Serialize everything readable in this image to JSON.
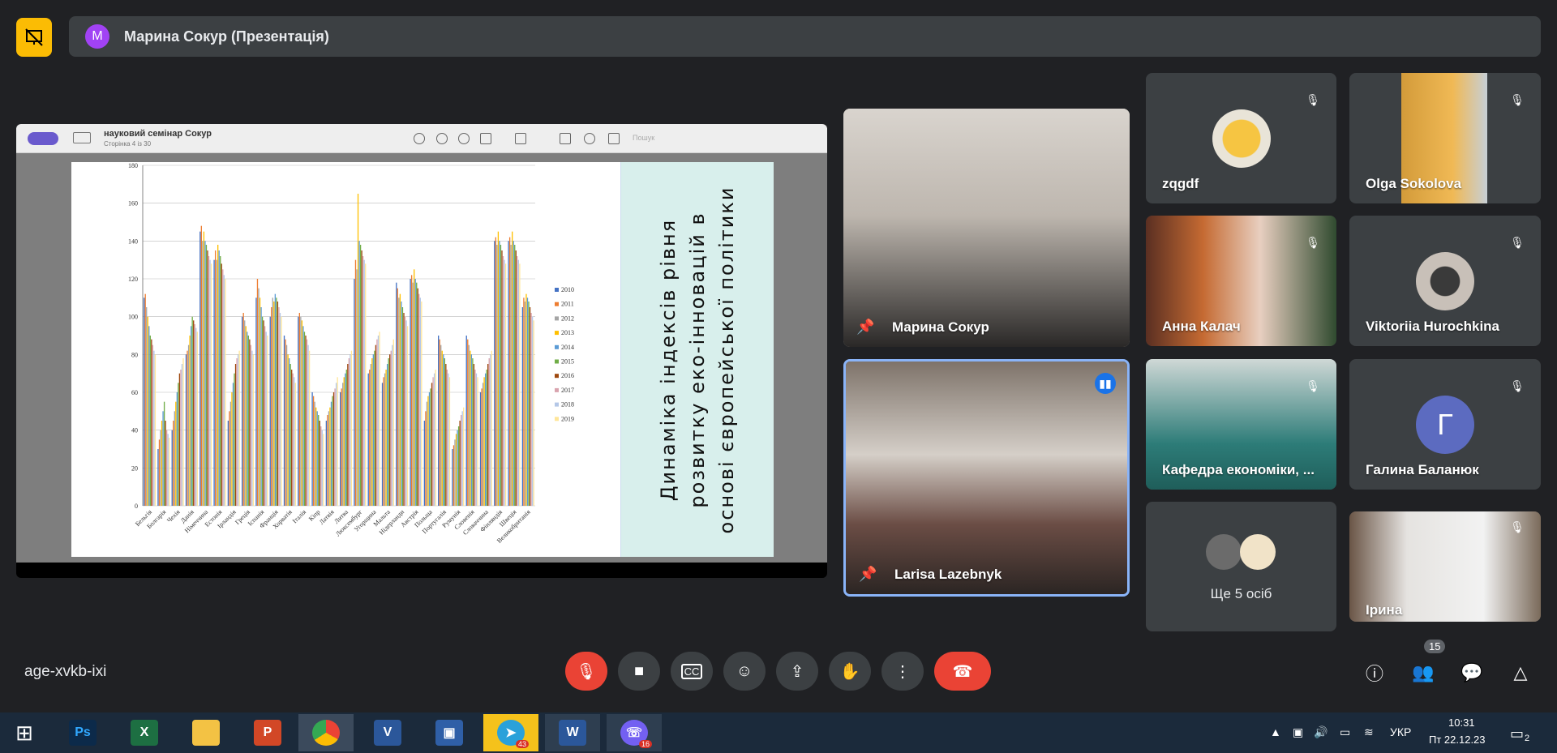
{
  "meeting": {
    "presenter_label": "Марина Сокур (Презентація)",
    "presenter_initial": "M",
    "code": "age-xvkb-ixi",
    "people_count": "15"
  },
  "viewer": {
    "doc_title": "науковий семінар Сокур",
    "doc_page": "Сторінка 4 із 30",
    "search_placeholder": "Пошук"
  },
  "slide": {
    "title": "Динаміка індексів рівня розвитку еко-інновацій в основі європейської політики"
  },
  "chart_data": {
    "type": "bar",
    "categories": [
      "Бельгія",
      "Болгарія",
      "Чехія",
      "Данія",
      "Німеччина",
      "Естонія",
      "Ірландія",
      "Греція",
      "Іспанія",
      "Франція",
      "Хорватія",
      "Італія",
      "Кіпр",
      "Латвія",
      "Литва",
      "Люксембург",
      "Угорщина",
      "Мальта",
      "Нідерланди",
      "Австрія",
      "Польща",
      "Португалія",
      "Румунія",
      "Словенія",
      "Словаччина",
      "Фінляндія",
      "Швеція",
      "Великобританія"
    ],
    "series": [
      {
        "name": "2010",
        "values": [
          110,
          30,
          40,
          80,
          145,
          130,
          45,
          100,
          110,
          100,
          90,
          100,
          60,
          45,
          60,
          120,
          70,
          65,
          118,
          120,
          45,
          90,
          30,
          90,
          60,
          140,
          140,
          105
        ]
      },
      {
        "name": "2011",
        "values": [
          112,
          35,
          45,
          82,
          148,
          135,
          50,
          102,
          120,
          105,
          88,
          102,
          58,
          48,
          62,
          130,
          72,
          68,
          115,
          122,
          50,
          88,
          32,
          88,
          62,
          142,
          142,
          110
        ]
      },
      {
        "name": "2012",
        "values": [
          105,
          40,
          50,
          85,
          140,
          130,
          55,
          98,
          115,
          110,
          85,
          100,
          55,
          50,
          65,
          125,
          75,
          70,
          110,
          118,
          55,
          85,
          35,
          85,
          65,
          138,
          138,
          108
        ]
      },
      {
        "name": "2013",
        "values": [
          100,
          45,
          55,
          90,
          145,
          138,
          60,
          95,
          110,
          108,
          80,
          98,
          52,
          52,
          68,
          165,
          78,
          72,
          112,
          125,
          58,
          82,
          38,
          82,
          68,
          145,
          145,
          112
        ]
      },
      {
        "name": "2014",
        "values": [
          95,
          50,
          60,
          95,
          140,
          135,
          65,
          92,
          105,
          112,
          78,
          95,
          50,
          55,
          70,
          140,
          80,
          75,
          108,
          120,
          60,
          80,
          40,
          80,
          70,
          140,
          140,
          110
        ]
      },
      {
        "name": "2015",
        "values": [
          90,
          55,
          65,
          100,
          138,
          132,
          70,
          90,
          100,
          110,
          75,
          92,
          48,
          58,
          72,
          138,
          82,
          78,
          105,
          118,
          62,
          78,
          42,
          78,
          72,
          138,
          138,
          108
        ]
      },
      {
        "name": "2016",
        "values": [
          88,
          45,
          70,
          98,
          135,
          128,
          75,
          88,
          98,
          108,
          72,
          90,
          45,
          60,
          75,
          135,
          85,
          80,
          102,
          115,
          65,
          75,
          45,
          75,
          75,
          135,
          135,
          105
        ]
      },
      {
        "name": "2017",
        "values": [
          85,
          40,
          72,
          96,
          132,
          125,
          78,
          85,
          95,
          105,
          70,
          88,
          42,
          62,
          78,
          132,
          88,
          82,
          100,
          112,
          68,
          72,
          48,
          72,
          78,
          132,
          132,
          102
        ]
      },
      {
        "name": "2018",
        "values": [
          82,
          38,
          75,
          94,
          130,
          122,
          80,
          82,
          92,
          102,
          68,
          85,
          40,
          65,
          80,
          130,
          90,
          85,
          98,
          110,
          70,
          70,
          50,
          70,
          80,
          130,
          130,
          100
        ]
      },
      {
        "name": "2019",
        "values": [
          80,
          36,
          78,
          92,
          128,
          120,
          82,
          80,
          90,
          100,
          65,
          82,
          38,
          68,
          82,
          128,
          92,
          88,
          95,
          108,
          72,
          68,
          52,
          68,
          82,
          128,
          128,
          98
        ]
      }
    ],
    "ylim": [
      0,
      180
    ],
    "yticks": [
      "180",
      "160",
      "140",
      "120",
      "100",
      "80",
      "60",
      "40",
      "20",
      "0"
    ],
    "legend_position": "right",
    "colors": [
      "#4472c4",
      "#ed7d31",
      "#a5a5a5",
      "#ffc000",
      "#5b9bd5",
      "#70ad47",
      "#9e480e",
      "#d9a3ae",
      "#b4c7e7",
      "#ffe699"
    ]
  },
  "participants": {
    "main1": "Марина Сокур",
    "main2": "Larisa Lazebnyk",
    "grid": [
      "zqgdf",
      "Olga Sokolova",
      "Анна Калач",
      "Viktoriia Hurochkina",
      "Кафедра економіки, ...",
      "Галина Баланюк",
      "Ще 5 осіб",
      "Ірина"
    ],
    "avatar_letter": "Г"
  },
  "taskbar": {
    "telegram_badge": "43",
    "viber_badge": "16",
    "lang": "УКР",
    "time": "10:31",
    "date": "Пт 22.12.23",
    "notif": "2"
  }
}
